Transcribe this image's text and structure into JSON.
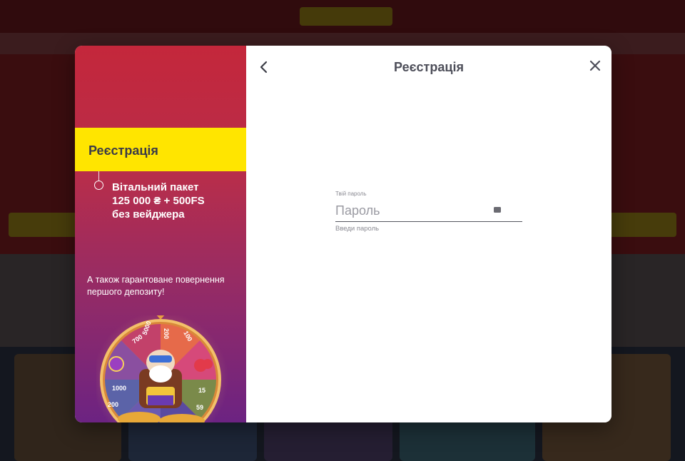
{
  "promo": {
    "band_title": "Реєстрація",
    "bonus_lines": [
      "Вітальний пакет",
      "125 000 ₴ + 500FS",
      "без вейджера"
    ],
    "subtitle": "А також гарантоване повернення першого депозиту!",
    "wheel_labels": [
      "700",
      "5000",
      "200",
      "100",
      "1000",
      "200",
      "15",
      "59"
    ]
  },
  "modal": {
    "title": "Реєстрація",
    "back_icon": "chevron-left-icon",
    "close_icon": "close-icon"
  },
  "password_field": {
    "label": "Твій пароль",
    "placeholder": "Пароль",
    "value": "",
    "hint": "Введи пароль",
    "toggle_icon": "password-toggle-icon"
  },
  "colors": {
    "band_yellow": "#ffe500",
    "promo_top": "#c4273b",
    "promo_bottom": "#6c2382",
    "title_text": "#4d4e59"
  }
}
